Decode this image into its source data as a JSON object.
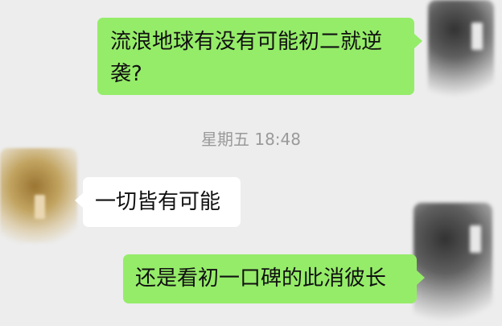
{
  "chat": {
    "messages": [
      {
        "sender": "self",
        "text": "流浪地球有没有可能初二就逆袭?"
      },
      {
        "sender": "other",
        "text": "一切皆有可能"
      },
      {
        "sender": "self",
        "text": "还是看初一口碑的此消彼长"
      }
    ],
    "timestamp": "星期五 18:48"
  },
  "colors": {
    "background": "#ededed",
    "self_bubble": "#95ec69",
    "other_bubble": "#ffffff",
    "timestamp_text": "#9a9a9a"
  },
  "icons": {
    "self_avatar": "blurred-avatar-icon",
    "other_avatar": "blurred-avatar-icon"
  }
}
